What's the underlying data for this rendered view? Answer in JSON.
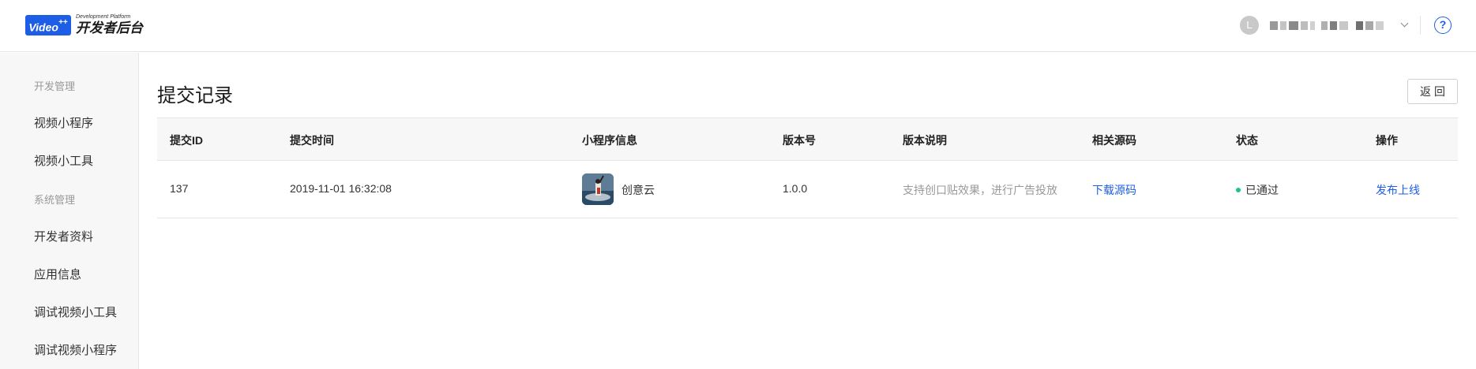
{
  "header": {
    "logo_badge": "Video",
    "logo_badge_sup": "++",
    "logo_sub": "Development Platform",
    "logo_main": "开发者后台",
    "user_initial": "L",
    "help_symbol": "?"
  },
  "sidebar": {
    "groups": [
      {
        "label": "开发管理",
        "items": [
          "视频小程序",
          "视频小工具"
        ]
      },
      {
        "label": "系统管理",
        "items": [
          "开发者资料",
          "应用信息",
          "调试视频小工具",
          "调试视频小程序"
        ]
      }
    ]
  },
  "main": {
    "title": "提交记录",
    "back_label": "返回"
  },
  "table": {
    "columns": [
      "提交ID",
      "提交时间",
      "小程序信息",
      "版本号",
      "版本说明",
      "相关源码",
      "状态",
      "操作"
    ],
    "rows": [
      {
        "id": "137",
        "time": "2019-11-01 16:32:08",
        "app_name": "创意云",
        "version": "1.0.0",
        "description": "支持创口贴效果，进行广告投放",
        "source_link": "下载源码",
        "status": "已通过",
        "status_color": "#1fbf9a",
        "action": "发布上线"
      }
    ]
  },
  "colors": {
    "accent": "#1e5ee6",
    "success": "#1fbf9a"
  }
}
